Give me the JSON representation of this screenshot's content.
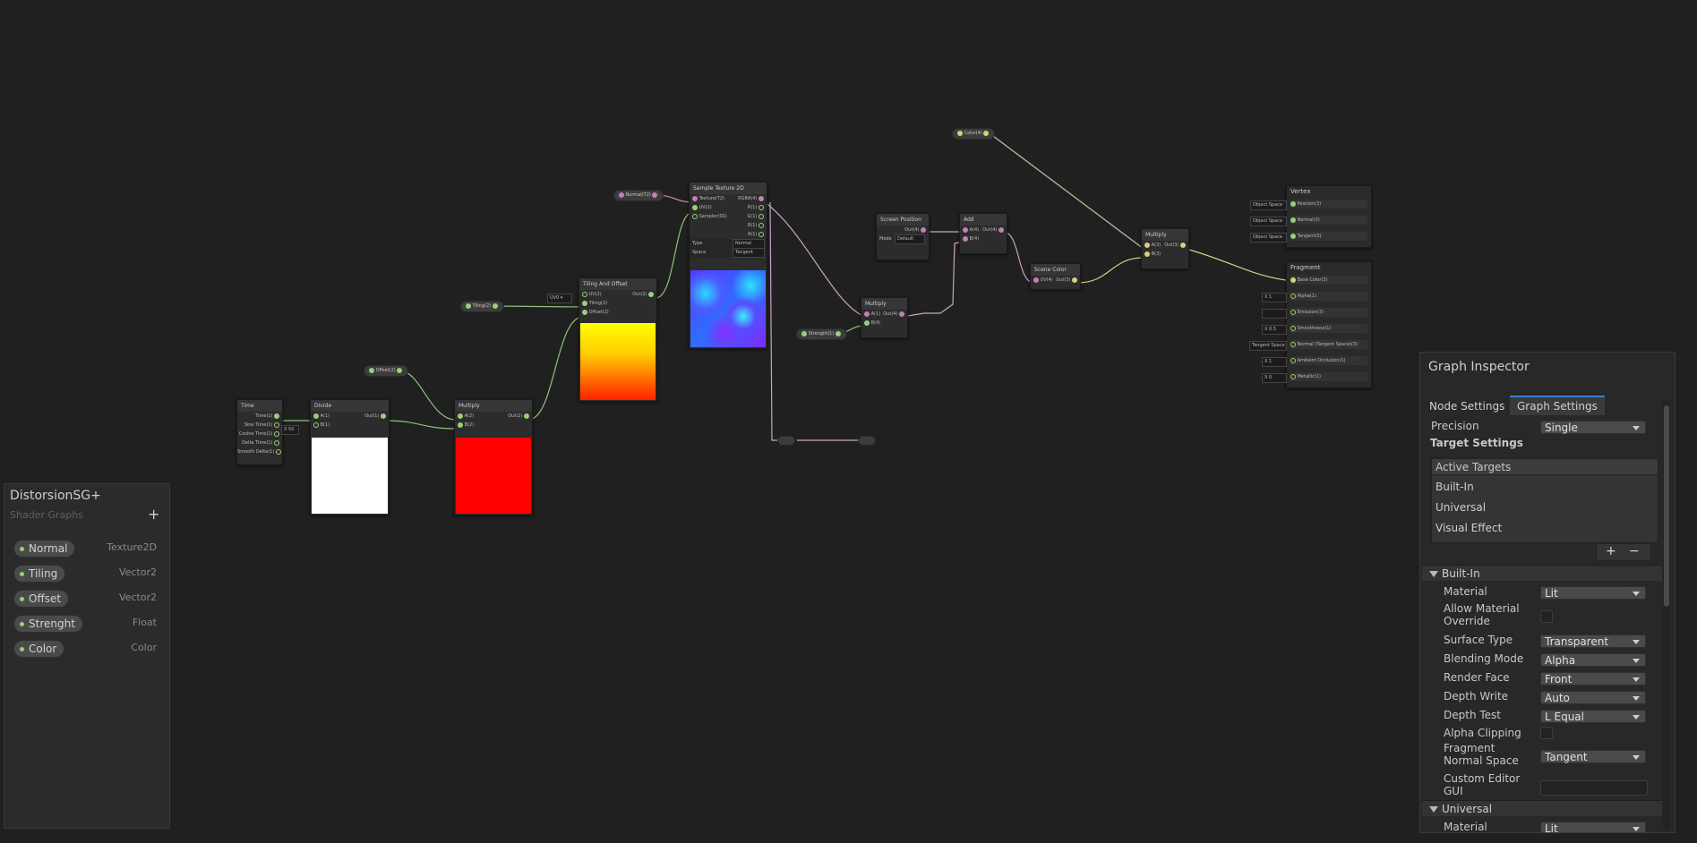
{
  "blackboard": {
    "title": "DistorsionSG+",
    "subtitle": "Shader Graphs",
    "add_label": "+",
    "properties": [
      {
        "name": "Normal",
        "type": "Texture2D"
      },
      {
        "name": "Tiling",
        "type": "Vector2"
      },
      {
        "name": "Offset",
        "type": "Vector2"
      },
      {
        "name": "Strenght",
        "type": "Float"
      },
      {
        "name": "Color",
        "type": "Color"
      }
    ]
  },
  "inspector": {
    "title": "Graph Inspector",
    "tabs": [
      "Node Settings",
      "Graph Settings"
    ],
    "active_tab": "Graph Settings",
    "precision_label": "Precision",
    "precision_value": "Single",
    "target_settings_label": "Target Settings",
    "active_targets_label": "Active Targets",
    "targets": [
      "Built-In",
      "Universal",
      "Visual Effect"
    ],
    "add_label": "+",
    "remove_label": "−",
    "builtin_section": "Built-In",
    "universal_section": "Universal",
    "fields": {
      "material": {
        "label": "Material",
        "value": "Lit"
      },
      "allow_override": {
        "label": "Allow Material Override"
      },
      "surface_type": {
        "label": "Surface Type",
        "value": "Transparent"
      },
      "blending_mode": {
        "label": "Blending Mode",
        "value": "Alpha"
      },
      "render_face": {
        "label": "Render Face",
        "value": "Front"
      },
      "depth_write": {
        "label": "Depth Write",
        "value": "Auto"
      },
      "depth_test": {
        "label": "Depth Test",
        "value": "L Equal"
      },
      "alpha_clipping": {
        "label": "Alpha Clipping"
      },
      "fragment_normal_space": {
        "label": "Fragment Normal Space",
        "value": "Tangent"
      },
      "custom_editor": {
        "label": "Custom Editor GUI"
      },
      "universal_material": {
        "label": "Material",
        "value": "Lit"
      }
    }
  },
  "nodes": {
    "time": {
      "title": "Time",
      "outputs": [
        "Time(1)",
        "Sine Time(1)",
        "Cosine Time(1)",
        "Delta Time(1)",
        "Smooth Delta(1)"
      ]
    },
    "divide": {
      "title": "Divide",
      "inputs": [
        "A(1)",
        "B(1)"
      ],
      "output": "Out(1)",
      "b_value": "50"
    },
    "multiply1": {
      "title": "Multiply",
      "inputs": [
        "A(2)",
        "B(2)"
      ],
      "output": "Out(2)"
    },
    "tiling": {
      "title": "Tiling And Offset",
      "inputs": [
        "UV(2)",
        "Tiling(2)",
        "Offset(2)"
      ],
      "output": "Out(2)",
      "uv_value": "UV0"
    },
    "sample": {
      "title": "Sample Texture 2D",
      "inputs": [
        "Texture(T2)",
        "UV(2)",
        "Sampler(SS)"
      ],
      "outputs": [
        "RGBA(4)",
        "R(1)",
        "G(1)",
        "B(1)",
        "A(1)"
      ],
      "type_label": "Type",
      "type_value": "Normal",
      "space_label": "Space",
      "space_value": "Tangent"
    },
    "screen": {
      "title": "Screen Position",
      "output": "Out(4)",
      "mode_label": "Mode",
      "mode_value": "Default"
    },
    "add": {
      "title": "Add",
      "inputs": [
        "A(4)",
        "B(4)"
      ],
      "output": "Out(4)"
    },
    "multiply2": {
      "title": "Multiply",
      "inputs": [
        "A(1)",
        "B(4)"
      ],
      "output": "Out(4)"
    },
    "scene_color": {
      "title": "Scene Color",
      "input": "UV(4)",
      "output": "Out(3)"
    },
    "multiply3": {
      "title": "Multiply",
      "inputs": [
        "A(3)",
        "B(3)"
      ],
      "output": "Out(3)"
    },
    "vertex": {
      "title": "Vertex",
      "ports": [
        "Position(3)",
        "Normal(3)",
        "Tangent(3)"
      ],
      "space": "Object Space"
    },
    "fragment": {
      "title": "Fragment",
      "ports": [
        "Base Color(3)",
        "Alpha(1)",
        "Emission(3)",
        "Smoothness(1)",
        "Normal (Tangent Space)(3)",
        "Ambient Occlusion(1)",
        "Metallic(1)"
      ],
      "values": [
        "1",
        "",
        "0.5",
        "Tangent Space",
        "1",
        "0"
      ]
    }
  },
  "props_on_graph": {
    "normal": "Normal(T2)",
    "tiling": "Tiling(2)",
    "offset": "Offset(2)",
    "strenght": "Strenght(1)",
    "color": "Color(4)"
  },
  "colors": {
    "accent": "#3d7ed6",
    "float_port": "#9bd07a",
    "texture_port": "#c57fb8",
    "preview_red": "#ff0000",
    "preview_white": "#ffffff"
  }
}
